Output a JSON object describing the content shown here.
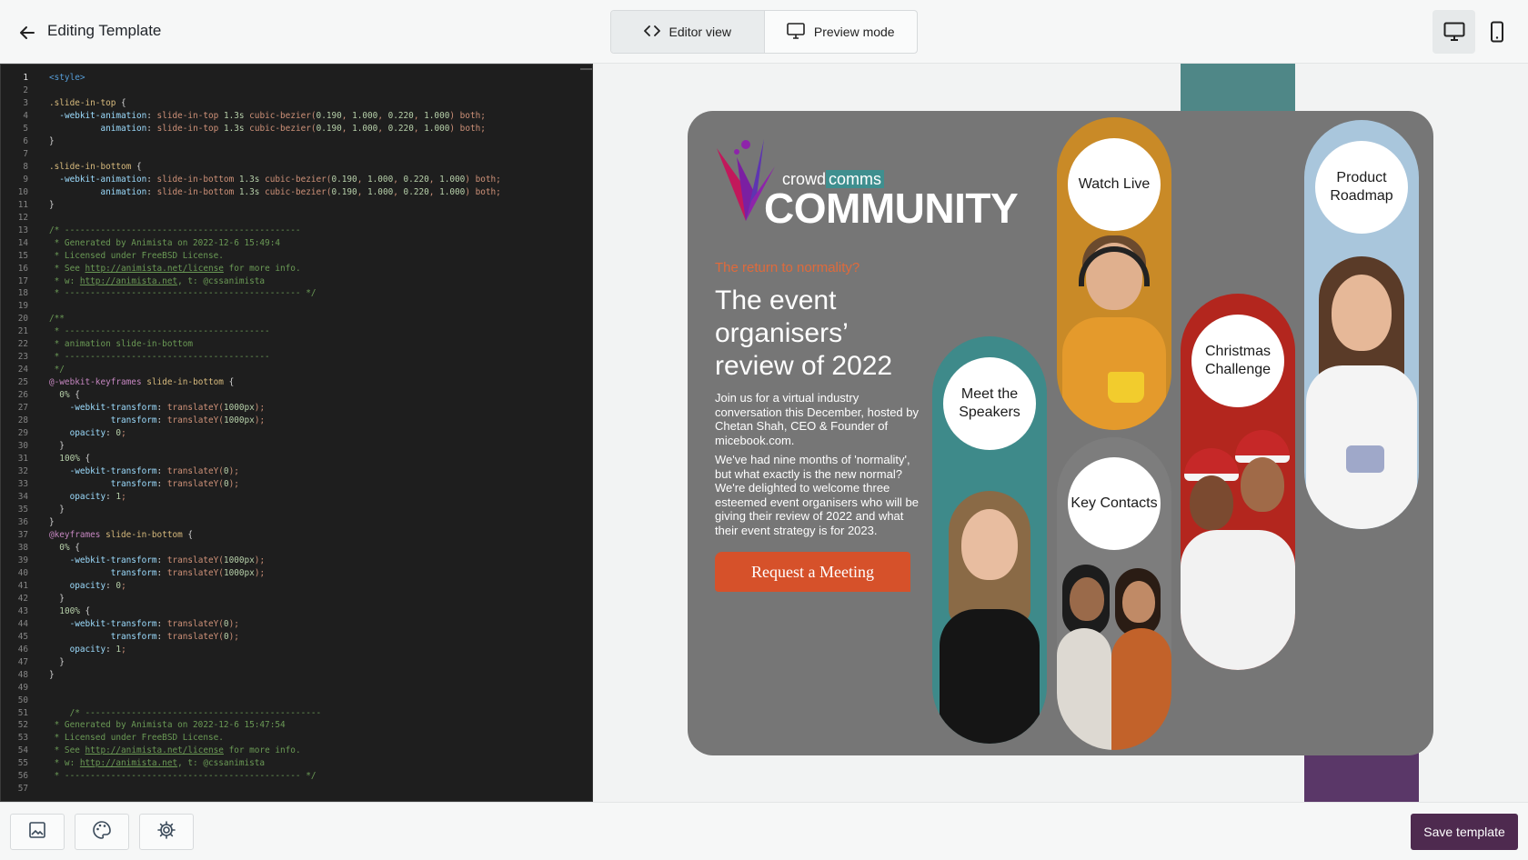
{
  "header": {
    "title": "Editing Template",
    "view_modes": [
      {
        "label": "Editor view",
        "icon": "code-icon",
        "active": true
      },
      {
        "label": "Preview mode",
        "icon": "monitor-icon",
        "active": false
      }
    ],
    "devices": [
      {
        "icon": "desktop-icon",
        "active": true
      },
      {
        "icon": "mobile-icon",
        "active": false
      }
    ]
  },
  "editor": {
    "lines": [
      "<style>",
      "",
      ".slide-in-top {",
      "  -webkit-animation: slide-in-top 1.3s cubic-bezier(0.190, 1.000, 0.220, 1.000) both;",
      "          animation: slide-in-top 1.3s cubic-bezier(0.190, 1.000, 0.220, 1.000) both;",
      "}",
      "",
      ".slide-in-bottom {",
      "  -webkit-animation: slide-in-bottom 1.3s cubic-bezier(0.190, 1.000, 0.220, 1.000) both;",
      "          animation: slide-in-bottom 1.3s cubic-bezier(0.190, 1.000, 0.220, 1.000) both;",
      "}",
      "",
      "/* ----------------------------------------------",
      " * Generated by Animista on 2022-12-6 15:49:4",
      " * Licensed under FreeBSD License.",
      " * See http://animista.net/license for more info.",
      " * w: http://animista.net, t: @cssanimista",
      " * ---------------------------------------------- */",
      "",
      "/**",
      " * ----------------------------------------",
      " * animation slide-in-bottom",
      " * ----------------------------------------",
      " */",
      "@-webkit-keyframes slide-in-bottom {",
      "  0% {",
      "    -webkit-transform: translateY(1000px);",
      "            transform: translateY(1000px);",
      "    opacity: 0;",
      "  }",
      "  100% {",
      "    -webkit-transform: translateY(0);",
      "            transform: translateY(0);",
      "    opacity: 1;",
      "  }",
      "}",
      "@keyframes slide-in-bottom {",
      "  0% {",
      "    -webkit-transform: translateY(1000px);",
      "            transform: translateY(1000px);",
      "    opacity: 0;",
      "  }",
      "  100% {",
      "    -webkit-transform: translateY(0);",
      "            transform: translateY(0);",
      "    opacity: 1;",
      "  }",
      "}",
      "",
      "",
      "    /* ----------------------------------------------",
      " * Generated by Animista on 2022-12-6 15:47:54",
      " * Licensed under FreeBSD License.",
      " * See http://animista.net/license for more info.",
      " * w: http://animista.net, t: @cssanimista",
      " * ---------------------------------------------- */",
      ""
    ]
  },
  "preview": {
    "brand_sub_prefix": "crowd",
    "brand_sub_highlight": "comms",
    "brand_main": "COMMUNITY",
    "kicker": "The return to normality?",
    "headline": "The event organisers’ review of 2022",
    "paragraph_1": "Join us for a virtual industry conversation this December, hosted by Chetan Shah, CEO & Founder of micebook.com.",
    "paragraph_2": "We've had nine months of 'normality', but what exactly is the new normal? We're delighted to welcome three esteemed event organisers who will be giving their review of 2022 and what their event strategy is for 2023.",
    "cta_label": "Request a Meeting",
    "circles": {
      "meet_speakers": "Meet the Speakers",
      "watch_live": "Watch Live",
      "key_contacts": "Key Contacts",
      "christmas": "Christmas Challenge",
      "product_roadmap": "Product Roadmap"
    },
    "colors": {
      "card": "#767676",
      "accent_orange": "#d6512a",
      "teal": "#3e8a8a",
      "mustard": "#c98a27",
      "red": "#b3261e",
      "sky": "#a9c6dc",
      "purple": "#5a3768"
    }
  },
  "footer": {
    "tools": [
      {
        "icon": "image-icon"
      },
      {
        "icon": "palette-icon"
      },
      {
        "icon": "gear-icon"
      }
    ],
    "save_label": "Save template"
  }
}
